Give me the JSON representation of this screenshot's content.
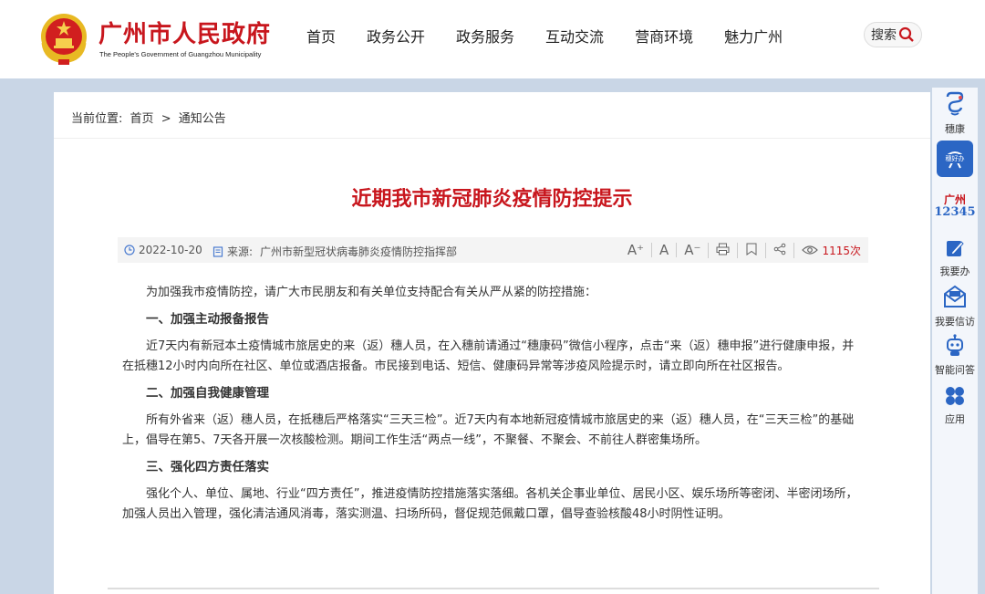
{
  "header": {
    "title": "广州市人民政府",
    "subtitle": "The People's Government of Guangzhou Municipality",
    "nav": [
      "首页",
      "政务公开",
      "政务服务",
      "互动交流",
      "营商环境",
      "魅力广州"
    ],
    "search_label": "搜索"
  },
  "breadcrumb": {
    "prefix": "当前位置:",
    "home": "首页",
    "sep": ">",
    "current": "通知公告"
  },
  "article": {
    "title": "近期我市新冠肺炎疫情防控提示",
    "date": "2022-10-20",
    "source_label": "来源:",
    "source": "广州市新型冠状病毒肺炎疫情防控指挥部",
    "views": "1115次",
    "tools": [
      "A⁺",
      "A",
      "A⁻"
    ],
    "intro": "为加强我市疫情防控，请广大市民朋友和有关单位支持配合有关从严从紧的防控措施：",
    "sections": [
      {
        "heading": "一、加强主动报备报告",
        "body": "近7天内有新冠本土疫情城市旅居史的来（返）穗人员，在入穗前请通过“穗康码”微信小程序，点击“来（返）穗申报”进行健康申报，并在抵穗12小时内向所在社区、单位或酒店报备。市民接到电话、短信、健康码异常等涉疫风险提示时，请立即向所在社区报告。"
      },
      {
        "heading": "二、加强自我健康管理",
        "body": "所有外省来（返）穗人员，在抵穗后严格落实“三天三检”。近7天内有本地新冠疫情城市旅居史的来（返）穗人员，在“三天三检”的基础上，倡导在第5、7天各开展一次核酸检测。期间工作生活“两点一线”，不聚餐、不聚会、不前往人群密集场所。"
      },
      {
        "heading": "三、强化四方责任落实",
        "body": "强化个人、单位、属地、行业“四方责任”，推进疫情防控措施落实落细。各机关企事业单位、居民小区、娱乐场所等密闭、半密闭场所，加强人员出入管理，强化清洁通风消毒，落实测温、扫场所码，督促规范佩戴口罩，倡导查验核酸48小时阴性证明。"
      }
    ]
  },
  "sidebar": {
    "items": [
      {
        "label": "穗康",
        "icon": "suikang-icon"
      },
      {
        "label": "",
        "icon": "suihaoban-icon",
        "badge": "穗好办"
      },
      {
        "label": "",
        "icon": "hotline-12345-icon",
        "logo_top": "广州",
        "logo_bottom": "12345"
      },
      {
        "label": "我要办",
        "icon": "edit-icon"
      },
      {
        "label": "我要信访",
        "icon": "mail-icon"
      },
      {
        "label": "智能问答",
        "icon": "robot-icon"
      },
      {
        "label": "应用",
        "icon": "apps-icon"
      }
    ]
  },
  "colors": {
    "brand_red": "#c8161d",
    "sidebar_blue": "#2b66c4",
    "background": "#c9d6e6"
  }
}
